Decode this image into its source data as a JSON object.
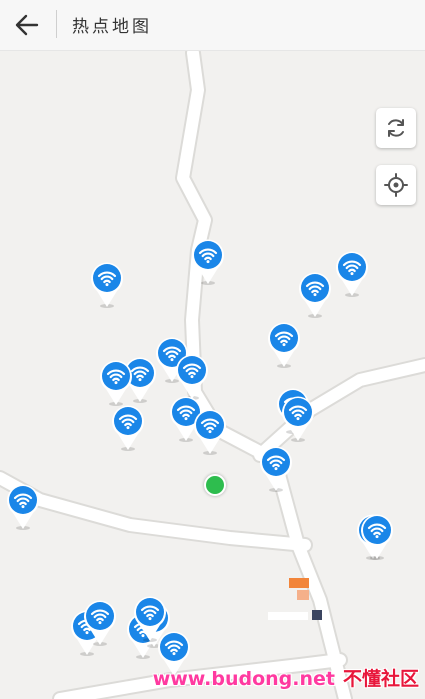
{
  "header": {
    "title": "热点地图",
    "back_icon": "arrow-left-icon"
  },
  "controls": [
    {
      "name": "refresh-button",
      "icon": "refresh-icon"
    },
    {
      "name": "locate-button",
      "icon": "crosshair-target-icon"
    }
  ],
  "hotspots": {
    "count": 24,
    "icon": "wifi-pin-icon",
    "color": "#1a86e8"
  },
  "user_location": {
    "icon": "user-location-dot",
    "color": "#2ebd4e"
  },
  "watermark": {
    "url": "www.budong.net",
    "label": "不懂社区"
  }
}
